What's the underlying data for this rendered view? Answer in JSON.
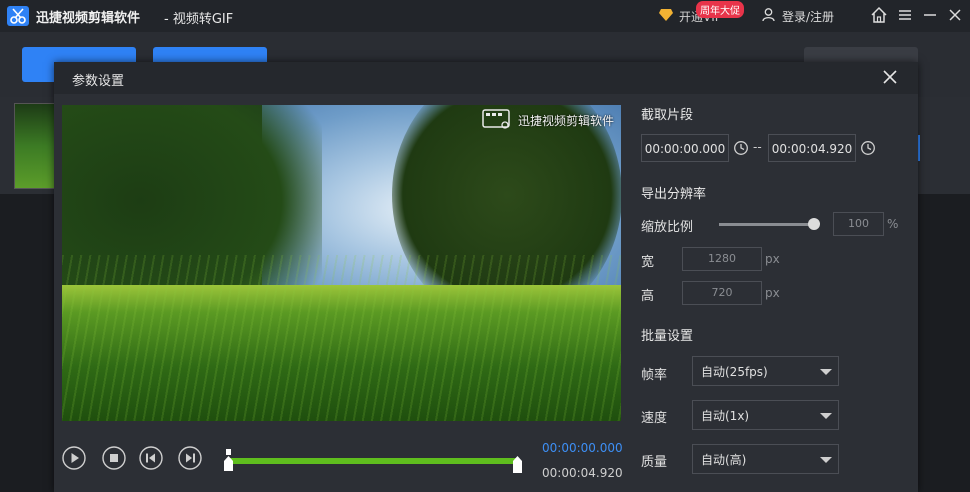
{
  "app": {
    "title": "迅捷视频剪辑软件",
    "subtitle": "- 视频转GIF",
    "vip_label": "开通VIP",
    "vip_badge": "周年大促",
    "login_label": "登录/注册"
  },
  "dialog": {
    "title": "参数设置",
    "watermark": "迅捷视频剪辑软件",
    "player": {
      "current_time": "00:00:00.000",
      "end_time": "00:00:04.920"
    },
    "clip": {
      "section_title": "截取片段",
      "start": "00:00:00.000",
      "separator": "--",
      "end": "00:00:04.920"
    },
    "resolution": {
      "section_title": "导出分辨率",
      "scale_label": "缩放比例",
      "scale_value": "100",
      "scale_unit": "%",
      "scale_level": 1.0,
      "width_label": "宽",
      "width_value": "1280",
      "width_unit": "px",
      "height_label": "高",
      "height_value": "720",
      "height_unit": "px"
    },
    "batch": {
      "section_title": "批量设置",
      "fps_label": "帧率",
      "fps_value": "自动(25fps)",
      "speed_label": "速度",
      "speed_value": "自动(1x)",
      "quality_label": "质量",
      "quality_value": "自动(高)"
    }
  },
  "colors": {
    "accent": "#2f82f5",
    "timeline": "#5fbe1e",
    "badge": "#e8344a"
  }
}
